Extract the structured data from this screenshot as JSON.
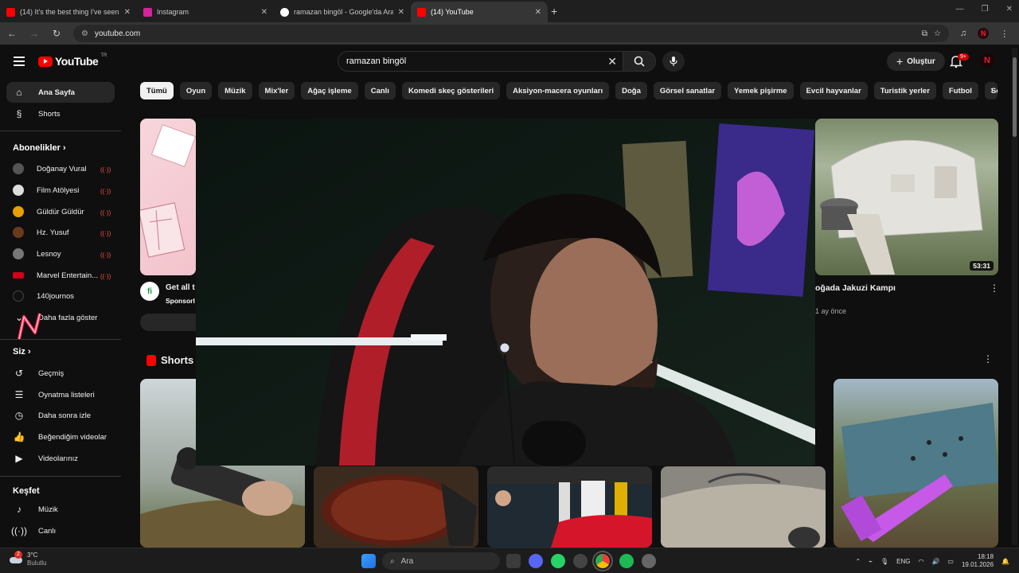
{
  "browser": {
    "tabs": [
      {
        "title": "(14) It's the best thing I've seen",
        "favicon_color": "#ff0000"
      },
      {
        "title": "Instagram",
        "favicon_color": "#d6249f"
      },
      {
        "title": "ramazan bingöl - Google'da Ara",
        "favicon_color": "#4285f4"
      },
      {
        "title": "(14) YouTube",
        "favicon_color": "#ff0000",
        "active": true
      }
    ],
    "url": "youtube.com",
    "profile_letter": "N"
  },
  "header": {
    "logo_text": "YouTube",
    "logo_country": "TR",
    "search_query": "ramazan bingöl",
    "create_label": "Oluştur",
    "notification_badge": "9+",
    "avatar_letter": "N"
  },
  "sidebar": {
    "home": "Ana Sayfa",
    "shorts": "Shorts",
    "subscriptions_header": "Abonelikler",
    "subscriptions": [
      {
        "name": "Doğanay Vural",
        "color": "#555"
      },
      {
        "name": "Film Atölyesi",
        "color": "#ddd"
      },
      {
        "name": "Güldür Güldür",
        "color": "#e6a100"
      },
      {
        "name": "Hz. Yusuf",
        "color": "#6b3a1a"
      },
      {
        "name": "Lesnoy",
        "color": "#777"
      },
      {
        "name": "Marvel Entertain...",
        "color": "#d0021b"
      },
      {
        "name": "140journos",
        "color": "#111"
      }
    ],
    "show_more": "Daha fazla göster",
    "you_header": "Siz",
    "you_items": [
      "Geçmiş",
      "Oynatma listeleri",
      "Daha sonra izle",
      "Beğendiğim videolar",
      "Videolarınız"
    ],
    "explore_header": "Keşfet",
    "explore_items": [
      "Müzik",
      "Canlı"
    ]
  },
  "chips": [
    "Tümü",
    "Oyun",
    "Müzik",
    "Mix'ler",
    "Ağaç işleme",
    "Canlı",
    "Komedi skeç gösterileri",
    "Aksiyon-macera oyunları",
    "Doğa",
    "Görsel sanatlar",
    "Yemek pişirme",
    "Evcil hayvanlar",
    "Turistik yerler",
    "Futbol",
    "Son yüklenen"
  ],
  "main": {
    "ad_title": "Get all t",
    "ad_sponsor": "Sponsorl",
    "video_title": "oğada Jakuzi Kampı",
    "video_duration": "53:31",
    "video_age": "1 ay önce",
    "shorts_header": "Shorts"
  },
  "taskbar": {
    "weather_temp": "3°C",
    "weather_desc": "Bulutlu",
    "weather_badge": "2",
    "search_placeholder": "Ara",
    "lang": "ENG",
    "time": "18:18",
    "date": "19.01.2026"
  }
}
